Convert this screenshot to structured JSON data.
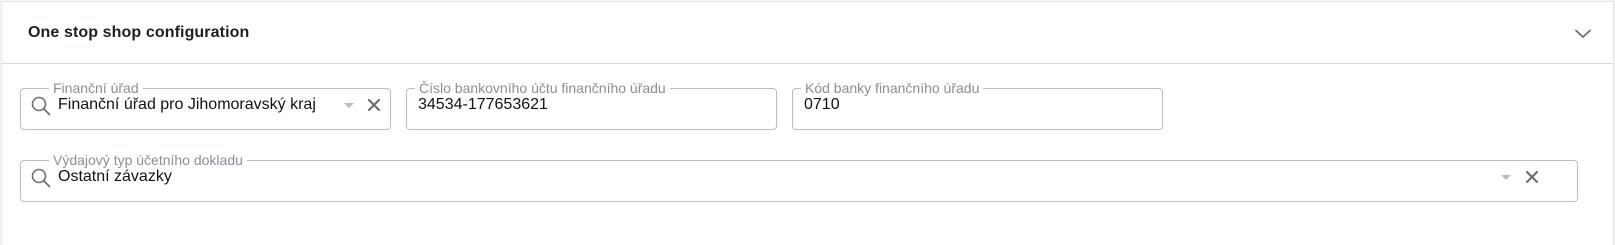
{
  "section": {
    "title": "One stop shop configuration",
    "collapse_icon": "chevron-down-icon"
  },
  "fields": {
    "tax_office": {
      "label": "Finanční úřad",
      "value": "Finanční úřad pro Jihomoravský kraj",
      "search_icon": "search-icon",
      "clear_icon": "close-icon"
    },
    "bank_account": {
      "label": "Číslo bankovního účtu finančního úřadu",
      "value": "34534-177653621"
    },
    "bank_code": {
      "label": "Kód banky finančního úřadu",
      "value": "0710"
    },
    "expense_doc_type": {
      "label": "Výdajový typ účetního dokladu",
      "value": "Ostatní závazky",
      "search_icon": "search-icon",
      "clear_icon": "close-icon"
    }
  },
  "colors": {
    "border": "#b9bcc4",
    "label": "#8a8e99",
    "text": "#111318",
    "icon": "#6b6f7a"
  }
}
